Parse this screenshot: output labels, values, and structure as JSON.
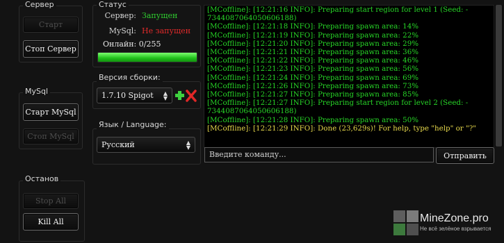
{
  "server": {
    "title": "Сервер",
    "start_label": "Старт",
    "stop_label": "Стоп Сервер"
  },
  "mysql": {
    "title": "MySql",
    "start_label": "Старт MySql",
    "stop_label": "Стоп MySql"
  },
  "shutdown": {
    "title": "Останов",
    "stop_all_label": "Stop All",
    "kill_all_label": "Kill All"
  },
  "status": {
    "title": "Статус",
    "server_label": "Сервер:",
    "server_value": "Запущен",
    "server_color": "#2fcc2f",
    "mysql_label": "MySql:",
    "mysql_value": "Не запущен",
    "mysql_color": "#e12a2a",
    "online_label": "Онлайн: 0/255",
    "progress": 1.0
  },
  "build": {
    "title": "Версия сборки:",
    "selected": "1.7.10 Spigot",
    "add_icon": "plus-icon",
    "remove_icon": "close-icon"
  },
  "language": {
    "title": "Язык / Language:",
    "selected": "Русский"
  },
  "console": {
    "lines": [
      {
        "text": "[MCoffline]: [12:21:16 INFO]: Preparing start region for level 1 (Seed: -",
        "color": "green"
      },
      {
        "text": "7344087064050606188)",
        "color": "green"
      },
      {
        "text": "[MCoffline]: [12:21:18 INFO]: Preparing spawn area: 14%",
        "color": "green"
      },
      {
        "text": "[MCoffline]: [12:21:19 INFO]: Preparing spawn area: 22%",
        "color": "green"
      },
      {
        "text": "[MCoffline]: [12:21:20 INFO]: Preparing spawn area: 29%",
        "color": "green"
      },
      {
        "text": "[MCoffline]: [12:21:21 INFO]: Preparing spawn area: 36%",
        "color": "green"
      },
      {
        "text": "[MCoffline]: [12:21:22 INFO]: Preparing spawn area: 46%",
        "color": "green"
      },
      {
        "text": "[MCoffline]: [12:21:23 INFO]: Preparing spawn area: 56%",
        "color": "green"
      },
      {
        "text": "[MCoffline]: [12:21:24 INFO]: Preparing spawn area: 69%",
        "color": "green"
      },
      {
        "text": "[MCoffline]: [12:21:26 INFO]: Preparing spawn area: 73%",
        "color": "green"
      },
      {
        "text": "[MCoffline]: [12:21:27 INFO]: Preparing spawn area: 85%",
        "color": "green"
      },
      {
        "text": "[MCoffline]: [12:21:27 INFO]: Preparing start region for level 2 (Seed: -",
        "color": "green"
      },
      {
        "text": "7344087064050606188)",
        "color": "green"
      },
      {
        "text": "[MCoffline]: [12:21:28 INFO]: Preparing spawn area: 50%",
        "color": "green"
      },
      {
        "text": "[MCoffline]: [12:21:29 INFO]: Done (23,629s)! For help, type \"help\" or \"?\"",
        "color": "yellow"
      }
    ],
    "input_placeholder": "Введите команду...",
    "send_label": "Отправить"
  },
  "watermark": {
    "name": "MineZone.pro",
    "tagline": "Не всё зелёное взрывается"
  }
}
